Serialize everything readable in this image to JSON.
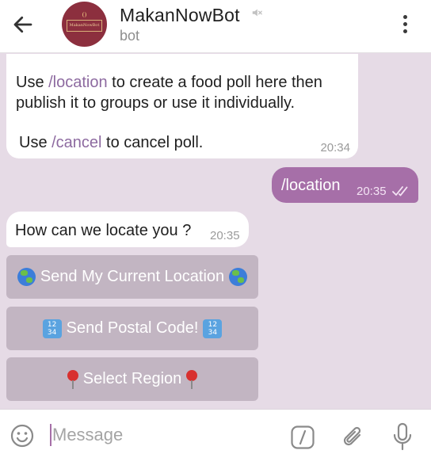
{
  "header": {
    "title": "MakanNowBot",
    "subtitle": "bot",
    "avatar_text": "MakanNowBot"
  },
  "messages": {
    "intro": {
      "line1_prefix": "Use ",
      "line1_cmd": "/location",
      "line1_suffix": " to create a food poll here then",
      "line2": "publish it to groups or use it individually.",
      "line3_prefix": "Use ",
      "line3_cmd": "/cancel",
      "line3_suffix": " to cancel poll.",
      "time": "20:34"
    },
    "outgoing": {
      "text": "/location",
      "time": "20:35"
    },
    "question": {
      "text": "How can we locate you ?",
      "time": "20:35"
    }
  },
  "keyboard": {
    "location": "Send My Current Location",
    "postal": "Send Postal Code!",
    "region": "Select Region",
    "num_icon_top": "12",
    "num_icon_bottom": "34"
  },
  "composer": {
    "placeholder": "Message"
  },
  "colors": {
    "accent": "#a66fa8",
    "chat_background": "#e6dbe6",
    "keyboard_button": "#c2b5c2",
    "command_link": "#8d6aa0"
  },
  "icons": [
    "back-arrow-icon",
    "muted-icon",
    "more-vert-icon",
    "double-check-icon",
    "globe-icon",
    "input-numbers-icon",
    "pin-icon",
    "emoji-icon",
    "bot-commands-icon",
    "attach-icon",
    "mic-icon"
  ]
}
